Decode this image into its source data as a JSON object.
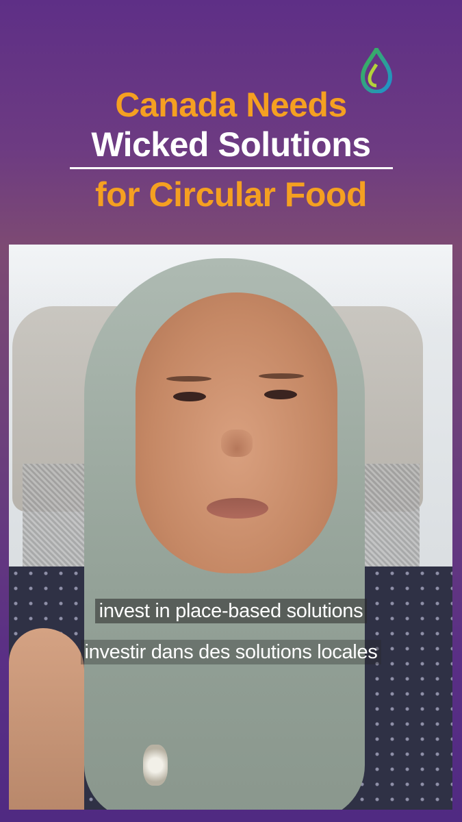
{
  "title": {
    "line1": "Canada Needs",
    "line2": "Wicked Solutions",
    "line3": "for Circular Food"
  },
  "colors": {
    "accent_orange": "#f5a021",
    "title_white": "#ffffff",
    "background_purple": "#5e2f86"
  },
  "logo": {
    "icon": "droplet-logo-icon"
  },
  "video": {
    "subtitle_en": "invest in place-based solutions",
    "subtitle_fr": "investir dans des solutions locales"
  }
}
